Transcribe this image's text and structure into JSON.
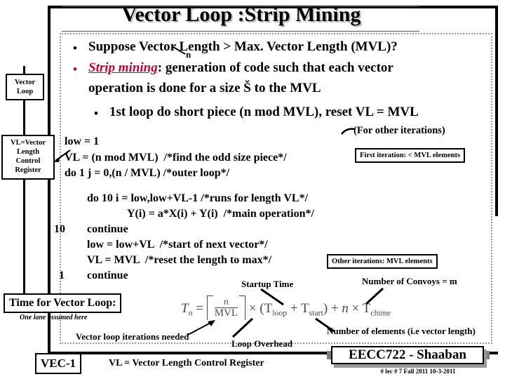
{
  "slide": {
    "title": "Vector Loop :Strip Mining",
    "bullets": [
      {
        "id": "bullet-mvl-question",
        "text_before": "Suppose Vector Length > Max. Vector Length (MVL)?",
        "annotation": "n"
      },
      {
        "id": "bullet-strip-mining",
        "term": "Strip mining",
        "text_after": ": generation of code such that each vector",
        "line2": "operation is done for a size Š to the MVL"
      },
      {
        "id": "bullet-first-loop",
        "text": "1st loop do short piece (n mod MVL), reset VL = MVL"
      }
    ],
    "for_other_iterations": "(For other iterations)",
    "code": [
      {
        "label": "",
        "text": "low = 1",
        "indent": 0
      },
      {
        "label": "",
        "text": "VL = (n mod MVL)  /*find the odd size piece*/",
        "indent": 0
      },
      {
        "label": "",
        "text": "do 1 j = 0,(n / MVL) /*outer loop*/",
        "indent": 0
      },
      {
        "label": "",
        "text": "do 10 i = low,low+VL-1 /*runs for length VL*/",
        "indent": 1
      },
      {
        "label": "",
        "text": "Y(i) = a*X(i) + Y(i)  /*main operation*/",
        "indent": 2
      },
      {
        "label": "10",
        "text": "continue",
        "indent": 1
      },
      {
        "label": "",
        "text": "low = low+VL  /*start of next vector*/",
        "indent": 1
      },
      {
        "label": "",
        "text": "VL = MVL  /*reset the length to max*/",
        "indent": 1
      },
      {
        "label": "1",
        "text": "continue",
        "indent": 1
      }
    ],
    "side_boxes": {
      "vector_loop": "Vector Loop",
      "vl_register": "VL=Vector Length Control Register"
    },
    "annotation_boxes": {
      "first_iteration": "First iteration: < MVL elements",
      "other_iterations": "Other iterations: MVL elements"
    },
    "time_section": {
      "label": "Time for Vector Loop:",
      "note": "One lane assumed here",
      "formula": {
        "lhs": "T",
        "lhs_sub": "n",
        "eq": "=",
        "frac_num": "n",
        "frac_den": "MVL",
        "times1": "×",
        "paren": "(T",
        "sub_loop": "loop",
        "plus": "+ T",
        "sub_start": "start",
        "close": ")",
        "plus2": "+",
        "n_var": "n",
        "times2": "×",
        "t_chime": "T",
        "sub_chime": "chime"
      },
      "annotations": {
        "startup_time": "Startup Time",
        "number_of_convoys": "Number of Convoys = m",
        "number_of_elements": "Number of elements (i.e vector length)",
        "loop_overhead": "Loop Overhead",
        "vector_loop_iterations": "Vector loop iterations needed"
      }
    },
    "footer": {
      "vec_tag": "VEC-1",
      "caption": "VL = Vector Length Control Register",
      "course": "EECC722 - Shaaban",
      "meta": "#  lec # 7    Fall 2011   10-3-2011"
    },
    "colors": {
      "accent_red": "#cc0033",
      "frame_black": "#000000",
      "formula_gray": "#4a4a4a",
      "shadow_gray": "#9a9a9a"
    }
  }
}
